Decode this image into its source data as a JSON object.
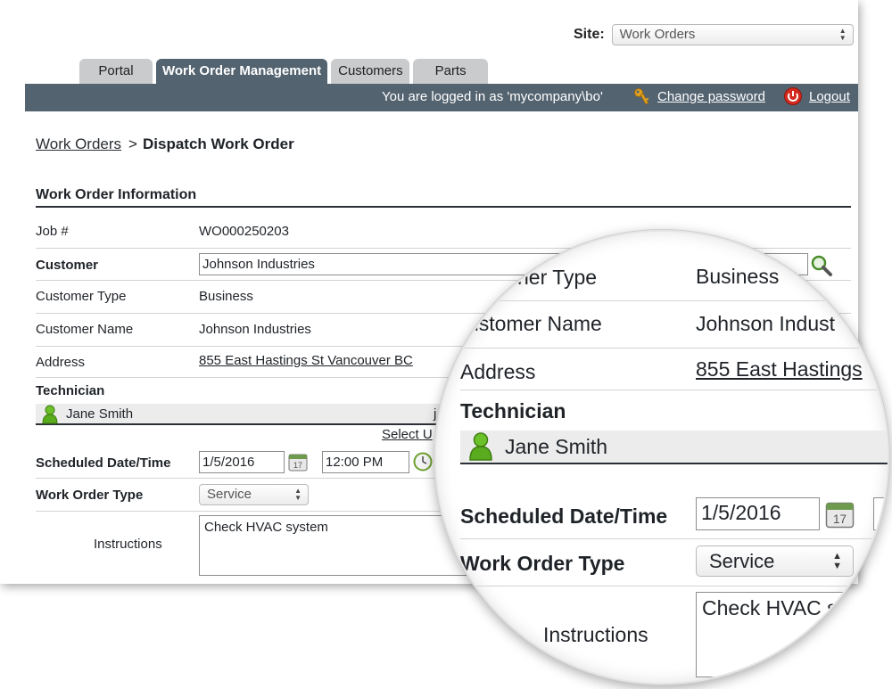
{
  "site": {
    "label": "Site:",
    "selected": "Work Orders"
  },
  "tabs": [
    {
      "label": "Portal",
      "active": false
    },
    {
      "label": "Work Order Management",
      "active": true
    },
    {
      "label": "Customers",
      "active": false
    },
    {
      "label": "Parts",
      "active": false
    }
  ],
  "topbar": {
    "logged_in_text": "You are logged in as 'mycompany\\bo'",
    "change_password": "Change password",
    "logout": "Logout"
  },
  "breadcrumb": {
    "parent": "Work Orders",
    "separator": ">",
    "current": "Dispatch Work Order"
  },
  "form": {
    "section_title": "Work Order Information",
    "job_label": "Job #",
    "job_value": "WO000250203",
    "customer_label": "Customer",
    "customer_value": "Johnson Industries",
    "customer_type_label": "Customer Type",
    "customer_type_value": "Business",
    "customer_name_label": "Customer Name",
    "customer_name_value": "Johnson Industries",
    "address_label": "Address",
    "address_value": "855 East Hastings St Vancouver BC",
    "technician_label": "Technician",
    "technician_name": "Jane Smith",
    "technician_truncated": "j",
    "select_link": "Select U",
    "scheduled_label": "Scheduled Date/Time",
    "date_value": "1/5/2016",
    "calendar_day": "17",
    "time_value": "12:00 PM",
    "type_label": "Work Order Type",
    "type_value": "Service",
    "instructions_label": "Instructions",
    "instructions_value": "Check HVAC system"
  },
  "magnifier": {
    "customer_type_label": "ner Type",
    "customer_type_value": "Business",
    "customer_name_label": "ustomer Name",
    "customer_name_value": "Johnson Indust",
    "address_label": "Address",
    "address_value": "855 East Hastings",
    "technician_label": "Technician",
    "technician_name": "Jane Smith",
    "scheduled_label": "Scheduled Date/Time",
    "date_value": "1/5/2016",
    "calendar_day": "17",
    "type_label": "Work Order Type",
    "type_value": "Service",
    "instructions_label": "Instructions",
    "instructions_value": "Check HVAC s"
  },
  "colors": {
    "header_bar": "#536370",
    "inactive_tab": "#c9cbcd",
    "accent_green": "#5aab1e",
    "logout_red": "#d42a1e"
  },
  "icons": [
    "key-icon",
    "power-icon",
    "search-icon",
    "person-icon",
    "calendar-icon",
    "clock-icon",
    "select-arrows-icon"
  ]
}
